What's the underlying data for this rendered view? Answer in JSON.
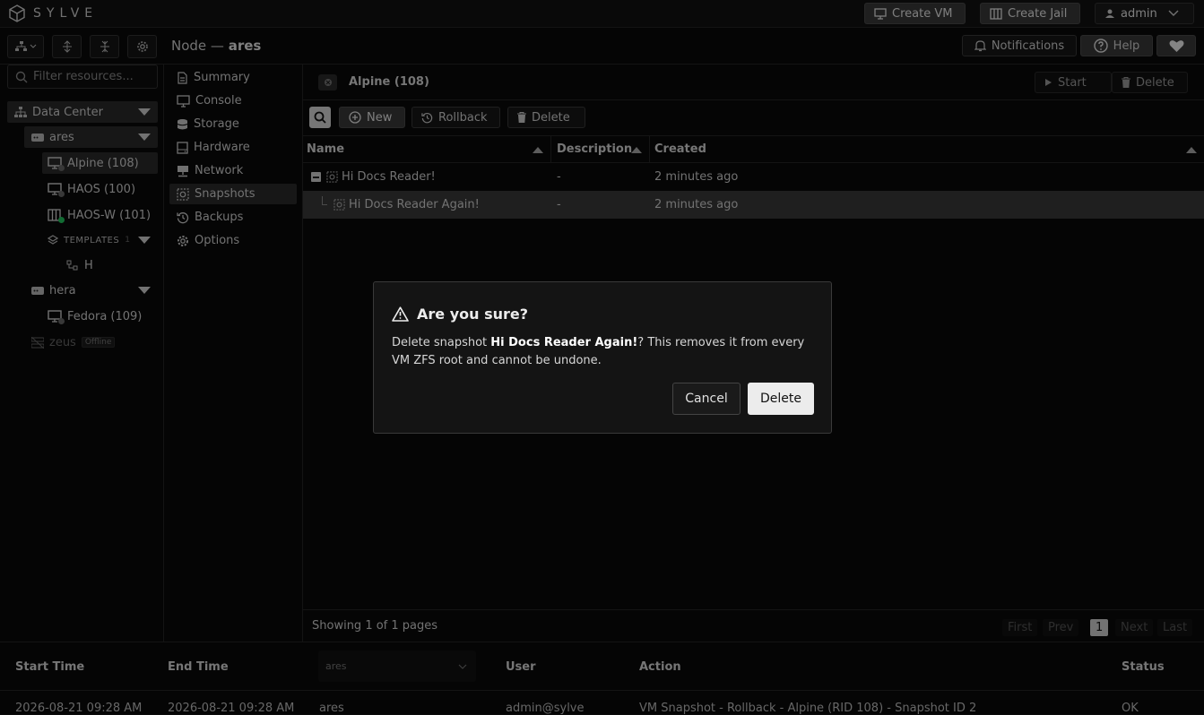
{
  "app": {
    "logo_text": "SYLVE"
  },
  "topbar": {
    "create_vm": "Create VM",
    "create_jail": "Create Jail",
    "user": "admin"
  },
  "header": {
    "node_prefix": "Node —",
    "node_name": "ares",
    "notifications": "Notifications",
    "help": "Help"
  },
  "search": {
    "placeholder": "Filter resources..."
  },
  "tree": {
    "datacenter": "Data Center",
    "ares": "ares",
    "alpine": "Alpine (108)",
    "haos": "HAOS (100)",
    "haosw": "HAOS-W (101)",
    "templates": "TEMPLATES",
    "templates_count": "1",
    "template_h": "H",
    "hera": "hera",
    "fedora": "Fedora (109)",
    "zeus": "zeus",
    "zeus_status": "Offline"
  },
  "menu": {
    "items": [
      "Summary",
      "Console",
      "Storage",
      "Hardware",
      "Network",
      "Snapshots",
      "Backups",
      "Options"
    ],
    "selected": "Snapshots"
  },
  "vm": {
    "title": "Alpine (108)",
    "start": "Start",
    "delete": "Delete"
  },
  "toolbar": {
    "new": "New",
    "rollback": "Rollback",
    "delete": "Delete"
  },
  "grid": {
    "columns": [
      "Name",
      "Description",
      "Created"
    ],
    "rows": [
      {
        "name": "Hi Docs Reader!",
        "description": "-",
        "created": "2 minutes ago"
      },
      {
        "name": "Hi Docs Reader Again!",
        "description": "-",
        "created": "2 minutes ago"
      }
    ]
  },
  "pager": {
    "showing": "Showing 1 of 1 pages",
    "first": "First",
    "prev": "Prev",
    "page": "1",
    "next": "Next",
    "last": "Last"
  },
  "tasks": {
    "columns": {
      "start": "Start Time",
      "end": "End Time",
      "node_filter": "ares",
      "user": "User",
      "action": "Action",
      "status": "Status"
    },
    "row": {
      "start": "2026-08-21 09:28 AM",
      "end": "2026-08-21 09:28 AM",
      "node": "ares",
      "user": "admin@sylve",
      "action": "VM Snapshot - Rollback - Alpine (RID 108) - Snapshot ID 2",
      "status": "OK"
    }
  },
  "dialog": {
    "title": "Are you sure?",
    "msg_before": "Delete snapshot ",
    "msg_name": "Hi Docs Reader Again!",
    "msg_after": "? This removes it from every VM ZFS root and cannot be undone.",
    "cancel": "Cancel",
    "confirm": "Delete"
  },
  "colors": {
    "background": "#0a0a0a",
    "panel": "#141414",
    "selected_row": "#3a3a3a",
    "online_dot": "#22c55e",
    "primary_button": "#ececec"
  }
}
